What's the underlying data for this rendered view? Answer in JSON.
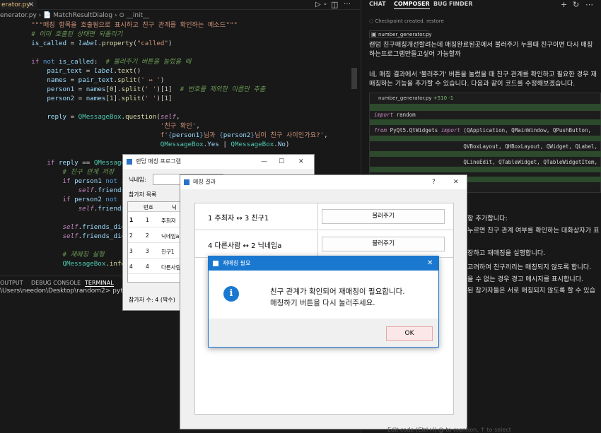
{
  "editor": {
    "tab_label": "erator.py",
    "breadcrumb": "enerator.py  ›  📄 MatchResultDialog  ›  ⊙ __init__",
    "lines": [
      "        \"\"\"매칭 항목을 호출됨으로 표시하고 친구 관계를 확인하는 메소드\"\"\"",
      "        # 이미 호출된 상태면 되돌리기",
      "        is_called = label.property(\"called\")",
      "",
      "        if not is_called:  # 불러주기 버튼을 눌렀을 때",
      "            pair_text = label.text()",
      "            names = pair_text.split(' ↔ ')",
      "            person1 = names[0].split(' ')[1]  # 번호를 제외한 이름만 추출",
      "            person2 = names[1].split(' ')[1]",
      "",
      "            reply = QMessageBox.question(self,",
      "                                         '친구 확인',",
      "                                         f'{person1}님과 {person2}님이 친구 사이인가요?',",
      "                                         QMessageBox.Yes | QMessageBox.No)",
      "",
      "",
      "            if reply == QMessageBox.Yes:",
      "                # 친구 관계 저장",
      "                if person1 not in self",
      "                    self.friends_dict[",
      "                if person2 not in self",
      "                    self.friends_dict[",
      "",
      "                self.friends_dict[pers",
      "                self.friends_dict[pers",
      "",
      "                # 재매칭 실행",
      "                QMessageBox.informatio"
    ]
  },
  "terminal": {
    "tabs": [
      "OUTPUT",
      "DEBUG CONSOLE",
      "TERMINAL"
    ],
    "prompt": "\\Users\\needon\\Desktop\\random2> python"
  },
  "chat": {
    "tabs": [
      "CHAT",
      "COMPOSER",
      "BUG FINDER"
    ],
    "checkpoint": "Checkpoint created. restore",
    "attachment": "number_generator.py",
    "user_message_1": "랜덤 친구매칭개선할려는데 매칭완료된곳에서 불러주기 누를때 친구이면 다시 매칭",
    "user_message_2": "하는프로그램만들고싶어 가능할까",
    "reply_1": "네, 매칭 결과에서 '불러주기' 버튼을 눌렀을 때 친구 관계를 확인하고 필요한 경우 재",
    "reply_2": "매칭하는 기능을 추가할 수 있습니다. 다음과 같이 코드를 수정해보겠습니다.",
    "card_file": "number_generator.py",
    "card_diff": "+510 -1",
    "card_code": [
      "import random",
      "from PyQt5.QtWidgets import (QApplication, QMainWindow, QPushButton,",
      "                            QVBoxLayout, QHBoxLayout, QWidget, QLabel,",
      "                            QLineEdit, QTableWidget, QTableWidgetItem, QD"
    ],
    "partial_lines": [
      "항 추가합니다:",
      "누르면 친구 관계 여부를 확인하는 대화상자가 표",
      "",
      "장하고 재매칭을 실행합니다.",
      "고려하여 친구끼리는 매칭되지 않도록 합니다.",
      "을 수 없는 경우 경고 메시지를 표시합니다.",
      "된 참가자들은 서로 매칭되지 않도록 할 수 있습"
    ],
    "bottom_hint": "Edit code (Ctrl+I) @ to mention, ↑ to select"
  },
  "main_window": {
    "title": "랜덤 매칭 프로그램",
    "nickname_label": "닉네임:",
    "list_label": "참가자 목록",
    "table_header": [
      "번호",
      "닉"
    ],
    "rows": [
      {
        "idx": "1",
        "num": "1",
        "name": "주최자"
      },
      {
        "idx": "2",
        "num": "2",
        "name": "닉네임a"
      },
      {
        "idx": "3",
        "num": "3",
        "name": "친구1"
      },
      {
        "idx": "4",
        "num": "4",
        "name": "다른사람"
      }
    ],
    "count": "참가자 수: 4 (짝수)"
  },
  "result_window": {
    "title": "매칭 결과",
    "help": "?",
    "rows": [
      {
        "pair": "1 주최자 ↔ 3 친구1",
        "button": "불러주기"
      },
      {
        "pair": "4 다른사람 ↔ 2 닉네임a",
        "button": "불러주기"
      }
    ]
  },
  "message_box": {
    "title": "재매칭 필요",
    "line1": "친구 관계가 확인되어 재매칭이 필요합니다.",
    "line2": "매칭하기 버튼을 다시 눌러주세요.",
    "ok": "OK"
  }
}
